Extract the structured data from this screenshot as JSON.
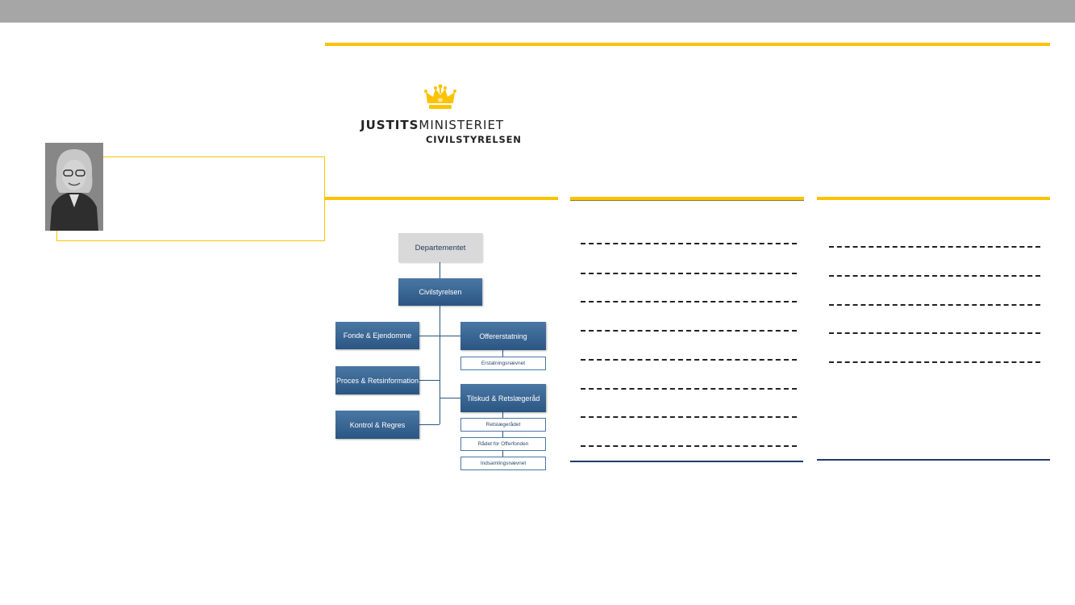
{
  "logo": {
    "line1_bold": "JUSTITS",
    "line1_rest": "MINISTERIET",
    "line2": "CIVILSTYRELSEN",
    "crown_color": "#fdc300"
  },
  "org_chart": {
    "top": "Departementet",
    "main": "Civilstyrelsen",
    "left_units": [
      "Fonde & Ejendomme",
      "Proces & Retsinformation",
      "Kontrol & Regres"
    ],
    "right_units": [
      {
        "label": "Offererstatning",
        "subs": [
          "Erstatningsnævnet"
        ]
      },
      {
        "label": "Tilskud & Retslægeråd",
        "subs": [
          "Retslægerådet",
          "Rådet for Offerfonden",
          "Indsamlingsnævnet"
        ]
      }
    ]
  },
  "colors": {
    "accent": "#fdc300",
    "top_bar": "#a6a6a6",
    "navy": "#1f3a6e",
    "box_dark": "#2b5683",
    "box_grey": "#d9d9d9"
  }
}
